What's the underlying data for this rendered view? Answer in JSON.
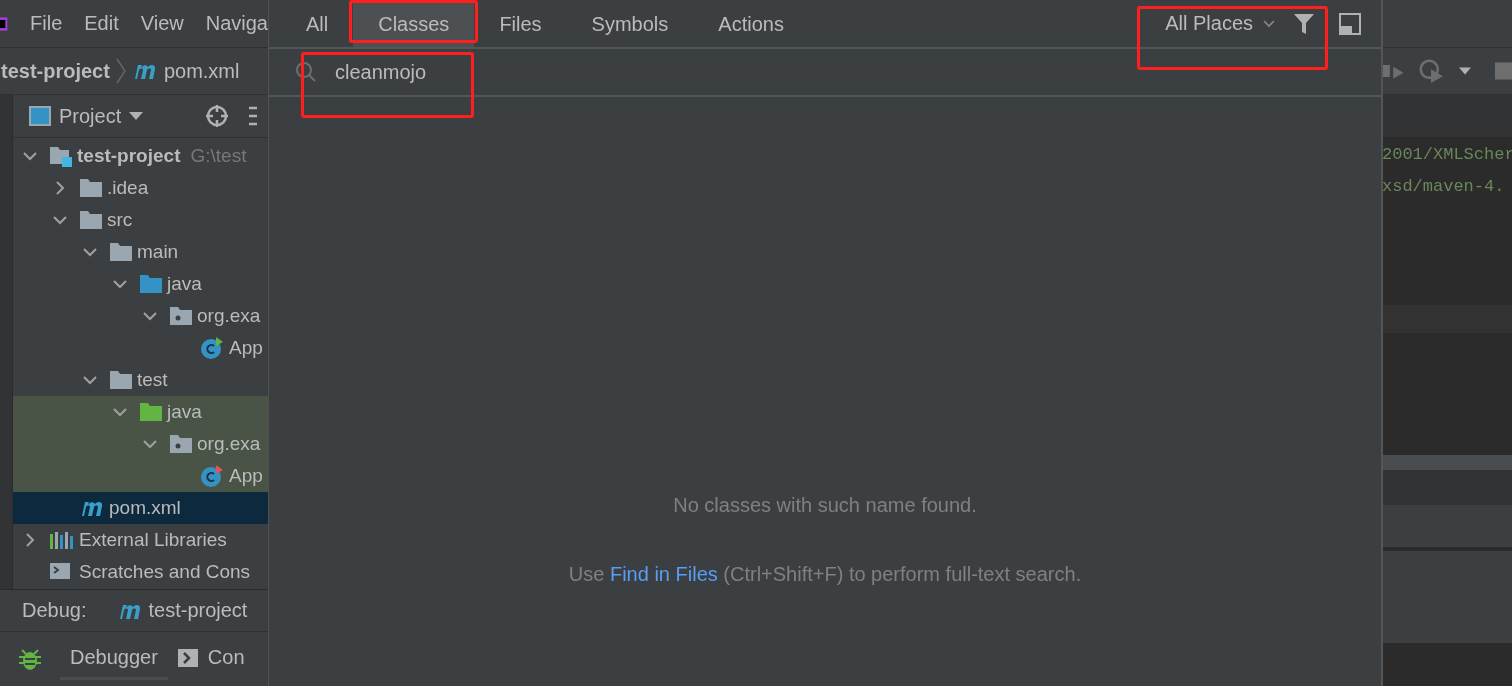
{
  "menu_bar": {
    "items": [
      "File",
      "Edit",
      "View",
      "Naviga"
    ]
  },
  "breadcrumb": {
    "project": "test-project",
    "file": "pom.xml"
  },
  "project_panel": {
    "title": "Project",
    "tree": [
      {
        "label": "test-project",
        "path": "G:\\test",
        "kind": "module",
        "expanded": true,
        "selected": false,
        "test_source": false,
        "children": [
          {
            "label": ".idea",
            "kind": "folder",
            "expanded": false,
            "selected": false,
            "test_source": false
          },
          {
            "label": "src",
            "kind": "folder",
            "expanded": true,
            "selected": false,
            "test_source": false,
            "children": [
              {
                "label": "main",
                "kind": "folder",
                "expanded": true,
                "selected": false,
                "test_source": false,
                "children": [
                  {
                    "label": "java",
                    "kind": "source-folder",
                    "expanded": true,
                    "selected": false,
                    "test_source": false,
                    "children": [
                      {
                        "label": "org.exa",
                        "kind": "package",
                        "expanded": true,
                        "selected": false,
                        "test_source": false,
                        "children": [
                          {
                            "label": "App",
                            "kind": "class",
                            "selected": false,
                            "test_source": false
                          }
                        ]
                      }
                    ]
                  }
                ]
              },
              {
                "label": "test",
                "kind": "folder",
                "expanded": true,
                "selected": false,
                "test_source": false,
                "children": [
                  {
                    "label": "java",
                    "kind": "test-folder",
                    "expanded": true,
                    "selected": false,
                    "test_source": true,
                    "children": [
                      {
                        "label": "org.exa",
                        "kind": "package",
                        "expanded": true,
                        "selected": false,
                        "test_source": true,
                        "children": [
                          {
                            "label": "App",
                            "kind": "test-class",
                            "selected": false,
                            "test_source": true
                          }
                        ]
                      }
                    ]
                  }
                ]
              }
            ]
          },
          {
            "label": "pom.xml",
            "kind": "maven",
            "selected": true,
            "test_source": false
          }
        ]
      },
      {
        "label": "External Libraries",
        "kind": "libraries",
        "expanded": false,
        "selected": false,
        "test_source": false
      },
      {
        "label": "Scratches and Cons",
        "kind": "scratches",
        "selected": false,
        "test_source": false
      }
    ]
  },
  "debug_bar": {
    "label": "Debug:",
    "config": "test-project",
    "tabs": [
      {
        "label": "Debugger",
        "selected": true
      },
      {
        "label": "Con",
        "selected": false
      }
    ]
  },
  "search_popup": {
    "tabs": [
      {
        "label": "All",
        "selected": false,
        "annotated": false
      },
      {
        "label": "Classes",
        "selected": true,
        "annotated": true
      },
      {
        "label": "Files",
        "selected": false,
        "annotated": false
      },
      {
        "label": "Symbols",
        "selected": false,
        "annotated": false
      },
      {
        "label": "Actions",
        "selected": false,
        "annotated": false
      }
    ],
    "scope": {
      "label": "All Places",
      "annotated": true
    },
    "search": {
      "value": "cleanmojo",
      "annotated": true
    },
    "empty_message": "No classes with such name found.",
    "hint": {
      "before": "Use ",
      "link": "Find in Files",
      "after": " (Ctrl+Shift+F) to perform full-text search."
    }
  },
  "editor": {
    "lines": [
      "2001/XMLScher",
      "xsd/maven-4."
    ]
  }
}
